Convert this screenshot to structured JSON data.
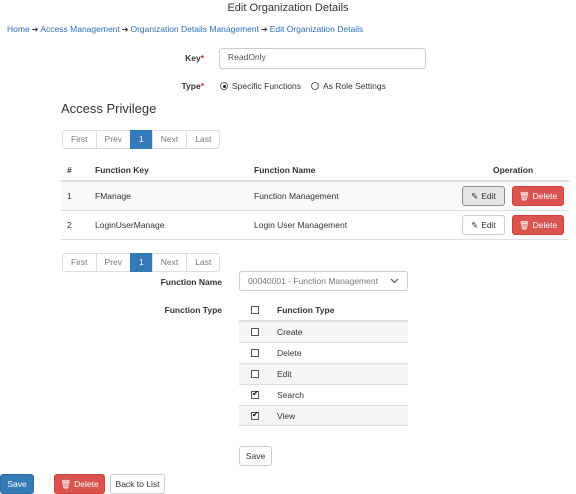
{
  "page_title": "Edit Organization Details",
  "breadcrumb": {
    "items": [
      "Home",
      "Access Management",
      "Organization Details Management",
      "Edit Organization Details"
    ]
  },
  "form": {
    "key_label": "Key",
    "key_value": "ReadOnly",
    "type_label": "Type",
    "type_options": [
      {
        "label": "Specific Functions",
        "selected": true
      },
      {
        "label": "As Role Settings",
        "selected": false
      }
    ]
  },
  "section_title": "Access Privilege",
  "pager": {
    "first": "First",
    "prev": "Prev",
    "current": "1",
    "next": "Next",
    "last": "Last"
  },
  "table": {
    "headers": {
      "num": "#",
      "key": "Function Key",
      "name": "Function Name",
      "op": "Operation"
    },
    "rows": [
      {
        "num": "1",
        "key": "FManage",
        "name": "Function Management",
        "edit": "Edit",
        "delete": "Delete"
      },
      {
        "num": "2",
        "key": "LoginUserManage",
        "name": "Login User Management",
        "edit": "Edit",
        "delete": "Delete"
      }
    ]
  },
  "function_form": {
    "name_label": "Function Name",
    "name_value": "00040001 - Function Management",
    "type_label": "Function Type",
    "type_header": "Function Type",
    "types": [
      {
        "label": "Create",
        "checked": false
      },
      {
        "label": "Delete",
        "checked": false
      },
      {
        "label": "Edit",
        "checked": false
      },
      {
        "label": "Search",
        "checked": true
      },
      {
        "label": "View",
        "checked": true
      }
    ],
    "save_label": "Save"
  },
  "footer": {
    "save": "Save",
    "delete": "Delete",
    "back": "Back to List"
  },
  "colors": {
    "primary": "#337ab7",
    "danger": "#d9534f",
    "link": "#2a6eb8"
  }
}
